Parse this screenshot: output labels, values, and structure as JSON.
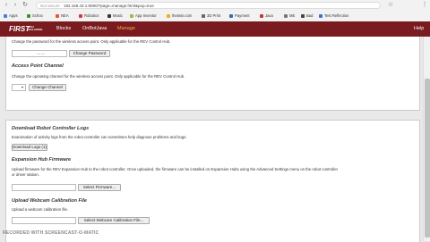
{
  "browser": {
    "security_label": "Not secure",
    "url": "192.168.43.1:8080/?page=manage.html&pop=true",
    "bookmarks": [
      {
        "label": "Apps",
        "color": "#4a7bd8"
      },
      {
        "label": "Schoo",
        "color": "#3a8f3a"
      },
      {
        "label": "NEA",
        "color": "#e05a2c"
      },
      {
        "label": "Robotics",
        "color": "#d13a3a"
      },
      {
        "label": "Music",
        "color": "#333333"
      },
      {
        "label": "App Inventor",
        "color": "#9bbd3c"
      },
      {
        "label": "thetwin.com",
        "color": "#e8b020"
      },
      {
        "label": "3D Print",
        "color": "#666666"
      },
      {
        "label": "Payment",
        "color": "#2f6fb3"
      },
      {
        "label": "Java",
        "color": "#c0392b"
      },
      {
        "label": "ME",
        "color": "#777777"
      },
      {
        "label": "Bad",
        "color": "#444444"
      },
      {
        "label": "Test Reflection",
        "color": "#3b6fd6"
      }
    ]
  },
  "appbar": {
    "logo_main": "FIRST",
    "logo_sub": "TECH CHALLENGE",
    "nav": [
      {
        "label": "Blocks",
        "active": false
      },
      {
        "label": "OnBotJava",
        "active": false
      },
      {
        "label": "Manage",
        "active": true
      }
    ],
    "help_label": "Help"
  },
  "panel_top": {
    "password_desc": "Change the password for the wireless access point. Only applicable for the REV Control Hub.",
    "password_value": "........",
    "change_password_btn": "Change Password",
    "channel_heading": "Access Point Channel",
    "channel_desc": "Change the operating channel for the wireless access point. Only applicable for the REV Control Hub.",
    "channel_btn": "Change Channel"
  },
  "panel_bottom": {
    "logs_heading": "Download Robot Controller Logs",
    "logs_desc": "Examination of activity logs from the robot controller can sometimes help diagnose problems and bugs.",
    "logs_btn": "Download Logs (1)",
    "firmware_heading": "Expansion Hub Firmware",
    "firmware_desc_1": "Upload firmware for the REV Expansion Hub to the robot controller. Once uploaded, the firmware can be installed on Expansion Hubs using the Advanced Settings menu on the robot controller",
    "firmware_desc_2": "or driver station.",
    "firmware_btn": "Select Firmware...",
    "webcam_heading": "Upload Webcam Calibration File",
    "webcam_desc": "Upload a webcam calibration file.",
    "webcam_btn": "Select Webcam Calibration File..."
  },
  "watermark": "RECORDED WITH SCREENCAST-O-MATIC"
}
